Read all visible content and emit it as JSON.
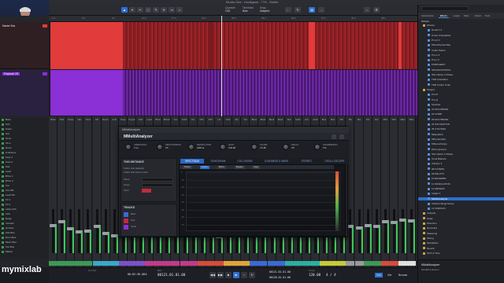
{
  "window": {
    "title": "Studio One - Hooligans - 77A - Studio"
  },
  "toolbar": {
    "quantize_label": "Quantize",
    "quantize_value": "1/16",
    "timebase_label": "Timebase",
    "timebase_value": "Bars",
    "snap_label": "Snap",
    "snap_value": "Adaptive"
  },
  "browser": {
    "tabs": [
      "Instruments",
      "Effects",
      "Loops",
      "Files",
      "Cloud",
      "Pool"
    ],
    "active_tab": "Effects",
    "filter_label": "iZotope",
    "selected_item": "MMultiAnalyzer",
    "items": [
      {
        "label": "iZotope",
        "type": "folder"
      },
      {
        "label": "Neutron 3",
        "type": "plugin"
      },
      {
        "label": "Ozone 9 Equalizer",
        "type": "plugin"
      },
      {
        "label": "Pro-Q 3",
        "type": "plugin"
      },
      {
        "label": "MAutoDynamicEq",
        "type": "plugin"
      },
      {
        "label": "Cutter Space",
        "type": "plugin"
      },
      {
        "label": "Pro-C 2",
        "type": "plugin"
      },
      {
        "label": "Pro-L 2",
        "type": "plugin"
      },
      {
        "label": "PURPLEEFT",
        "type": "plugin"
      },
      {
        "label": "SPACECONTROL",
        "type": "plugin"
      },
      {
        "label": "SSL Native X-Phase",
        "type": "plugin"
      },
      {
        "label": "TDR Kotelnikov",
        "type": "plugin"
      },
      {
        "label": "TDR Limiter 6 GE",
        "type": "plugin"
      },
      {
        "label": "Plugins",
        "type": "folder"
      },
      {
        "label": "Pro-R",
        "type": "plugin"
      },
      {
        "label": "Pro-Q",
        "type": "plugin"
      },
      {
        "label": "Soothe2",
        "type": "plugin"
      },
      {
        "label": "01 MULTIBAND",
        "type": "plugin"
      },
      {
        "label": "02 COMP",
        "type": "plugin"
      },
      {
        "label": "03 MULTIBAND",
        "type": "plugin"
      },
      {
        "label": "04 SATURATION",
        "type": "plugin"
      },
      {
        "label": "05 UTILITIES",
        "type": "plugin"
      },
      {
        "label": "MEqualizer",
        "type": "plugin"
      },
      {
        "label": "MDynamicEq",
        "type": "plugin"
      },
      {
        "label": "MStereoScope",
        "type": "plugin"
      },
      {
        "label": "MCompressor",
        "type": "plugin"
      },
      {
        "label": "SSL Native X-Phase",
        "type": "plugin"
      },
      {
        "label": "Tonal Balance",
        "type": "plugin"
      },
      {
        "label": "Vulcano 3",
        "type": "plugin"
      },
      {
        "label": "08 FILTERS",
        "type": "plugin"
      },
      {
        "label": "09 DELAYS",
        "type": "plugin"
      },
      {
        "label": "10 REVERBS",
        "type": "plugin"
      },
      {
        "label": "11 MODULATION",
        "type": "plugin"
      },
      {
        "label": "12 METERS",
        "type": "plugin"
      },
      {
        "label": "Insight 2",
        "type": "plugin"
      },
      {
        "label": "MMultiAnalyzer",
        "type": "plugin"
      },
      {
        "label": "Clarities Mega Scope",
        "type": "plugin"
      },
      {
        "label": "13 VARIOUS",
        "type": "plugin"
      },
      {
        "label": "Analysis",
        "type": "folder"
      },
      {
        "label": "Delay",
        "type": "folder"
      },
      {
        "label": "Distortion",
        "type": "folder"
      },
      {
        "label": "Dynamics",
        "type": "folder"
      },
      {
        "label": "Mastering",
        "type": "folder"
      },
      {
        "label": "Mixing",
        "type": "folder"
      },
      {
        "label": "Modulation",
        "type": "folder"
      },
      {
        "label": "Reverb",
        "type": "folder"
      },
      {
        "label": "Pitch & Time",
        "type": "folder"
      }
    ],
    "info_title": "MMultiAnalyzer",
    "info_vendor": "MeldaProduction"
  },
  "arrangement": {
    "ruler": [
      "1.1",
      "5.1",
      "9.1",
      "13.1",
      "17.1",
      "21.1",
      "25.1",
      "29.1",
      "33.1",
      "37.1",
      "41.1",
      "45.1"
    ],
    "playhead_bar": 25,
    "clips": [
      {
        "track": "Master Bus",
        "color": "#e23b3b"
      },
      {
        "track": "Playback VR",
        "color": "#8b2fd6"
      }
    ],
    "track_headers": [
      {
        "label": "Master Bus"
      },
      {
        "label": "Playback VR"
      }
    ]
  },
  "mixer_list": [
    "Bass",
    "Kick",
    "Snare",
    "Hat",
    "Toms",
    "OH L",
    "Room",
    "Ambience",
    "Keys 1",
    "Keys 2",
    "Pad",
    "Lead",
    "BVox 1",
    "BVox 2",
    "Vox",
    "Vox Dbl",
    "Lead VR",
    "FX 1",
    "FX 2",
    "Label with",
    "Verb",
    "Delay",
    "Vocoder",
    "Hi Pass",
    "Kick Bus",
    "Drum Bus",
    "Music Bus",
    "Vox Bus",
    "Master"
  ],
  "mixer_channels": [
    {
      "name": "Bass",
      "color": "#3c9a55",
      "level": 0.62
    },
    {
      "name": "Kick",
      "color": "#3c9a55",
      "level": 0.72
    },
    {
      "name": "Snare",
      "color": "#3c9a55",
      "level": 0.55
    },
    {
      "name": "Hat",
      "color": "#3c9a55",
      "level": 0.48
    },
    {
      "name": "Toms",
      "color": "#3c9a55",
      "level": 0.5
    },
    {
      "name": "OH",
      "color": "#3aa8c8",
      "level": 0.6
    },
    {
      "name": "Room",
      "color": "#3aa8c8",
      "level": 0.45
    },
    {
      "name": "Amb",
      "color": "#3aa8c8",
      "level": 0.4
    },
    {
      "name": "Keys",
      "color": "#7c4fd0",
      "level": 0.55
    },
    {
      "name": "Keys2",
      "color": "#7c4fd0",
      "level": 0.5
    },
    {
      "name": "Pad",
      "color": "#7c4fd0",
      "level": 0.45
    },
    {
      "name": "Lead",
      "color": "#c23a8a",
      "level": 0.58
    },
    {
      "name": "BVox",
      "color": "#c23a8a",
      "level": 0.52
    },
    {
      "name": "BVox2",
      "color": "#c23a8a",
      "level": 0.5
    },
    {
      "name": "Vox",
      "color": "#c23a8a",
      "level": 0.66
    },
    {
      "name": "VoxD",
      "color": "#c23a8a",
      "level": 0.6
    },
    {
      "name": "Vox",
      "color": "#c23a8a",
      "level": 0.5
    },
    {
      "name": "FX1",
      "color": "#d84a3a",
      "level": 0.4
    },
    {
      "name": "FX2",
      "color": "#d84a3a",
      "level": 0.42
    },
    {
      "name": "Lbl",
      "color": "#d84a3a",
      "level": 0.38
    },
    {
      "name": "Verb",
      "color": "#e0a53a",
      "level": 0.55
    },
    {
      "name": "Dly",
      "color": "#e0a53a",
      "level": 0.5
    },
    {
      "name": "Voc",
      "color": "#e0a53a",
      "level": 0.45
    },
    {
      "name": "Bus1",
      "color": "#3a6ad8",
      "level": 0.7
    },
    {
      "name": "Bus2",
      "color": "#3a6ad8",
      "level": 0.66
    },
    {
      "name": "Bus3",
      "color": "#3a6ad8",
      "level": 0.6
    },
    {
      "name": "Bus4",
      "color": "#3a6ad8",
      "level": 0.62
    },
    {
      "name": "Sub",
      "color": "#2ab0a0",
      "level": 0.58
    },
    {
      "name": "Sub2",
      "color": "#2ab0a0",
      "level": 0.5
    },
    {
      "name": "Aux",
      "color": "#2ab0a0",
      "level": 0.48
    },
    {
      "name": "Aux2",
      "color": "#2ab0a0",
      "level": 0.46
    },
    {
      "name": "Bus",
      "color": "#c8c83a",
      "level": 0.52
    },
    {
      "name": "Bus",
      "color": "#c8c83a",
      "level": 0.5
    },
    {
      "name": "Mix",
      "color": "#c8c83a",
      "level": 0.55
    },
    {
      "name": "Mix",
      "color": "#9a9a9a",
      "level": 0.6
    },
    {
      "name": "Mix",
      "color": "#9a9a9a",
      "level": 0.58
    },
    {
      "name": "Out",
      "color": "#3c9a55",
      "level": 0.62
    },
    {
      "name": "Out",
      "color": "#3c9a55",
      "level": 0.6
    },
    {
      "name": "Mstr",
      "color": "#d84a3a",
      "level": 0.72
    },
    {
      "name": "Mstr",
      "color": "#d84a3a",
      "level": 0.7
    },
    {
      "name": "Main",
      "color": "#e0e0e0",
      "level": 0.75
    },
    {
      "name": "Main",
      "color": "#e0e0e0",
      "level": 0.74
    }
  ],
  "plugin": {
    "window_title": "MMultiAnalyzer",
    "name": "MMultiAnalyzer",
    "knobs": [
      {
        "label": "AVERAGING",
        "value": "0 ms"
      },
      {
        "label": "SMOOTHNESS",
        "value": "0.5"
      },
      {
        "label": "RESOLUTION",
        "value": "4096 sa"
      },
      {
        "label": "GAIN",
        "value": "0.00 dB"
      },
      {
        "label": "SLOPE",
        "value": "4.5 dB"
      },
      {
        "label": "DECAY",
        "value": "Off"
      },
      {
        "label": "SHARPENING",
        "value": "0 %"
      }
    ],
    "tabs": [
      "SPECTRUM",
      "SONOGRAM",
      "COLLISIONS",
      "LOUDNESS & WAVE",
      "STEREO",
      "OSCILLOSCOPE"
    ],
    "active_tab": "SPECTRUM",
    "instance_title": "THIS INSTANCE",
    "instance_rows": [
      "Follow host playback",
      "Follow host stereo mode",
      "Name",
      "Group",
      "Color"
    ],
    "tracks_title": "TRACKS",
    "tracks_rows": [
      "Bass",
      "Kick",
      "Vocal"
    ],
    "graph_labels": [
      "0",
      "-10",
      "-20",
      "-30",
      "-40",
      "-50",
      "-60",
      "-70"
    ],
    "spec_buttons": [
      "Preset",
      "Stereo",
      "Mono",
      "Bypass",
      "Copy"
    ]
  },
  "transport": {
    "sample_rate": "44.1 kHz",
    "position": "00121.01.01.00",
    "time": "00:02:36.864",
    "loop_start": "00121.01.01.00",
    "loop_end": "00128.01.01.00",
    "tempo": "120.00",
    "signature": "4 / 4",
    "position_label": "Bars",
    "tempo_label": "Tempo",
    "edit_label": "Edit",
    "mix_label": "Mix",
    "browse_label": "Browse"
  },
  "overlay_logo": "mymixlab",
  "colors": {
    "accent": "#2d6fd1",
    "red_clip": "#e23b3b",
    "purple_clip": "#8b2fd6"
  }
}
